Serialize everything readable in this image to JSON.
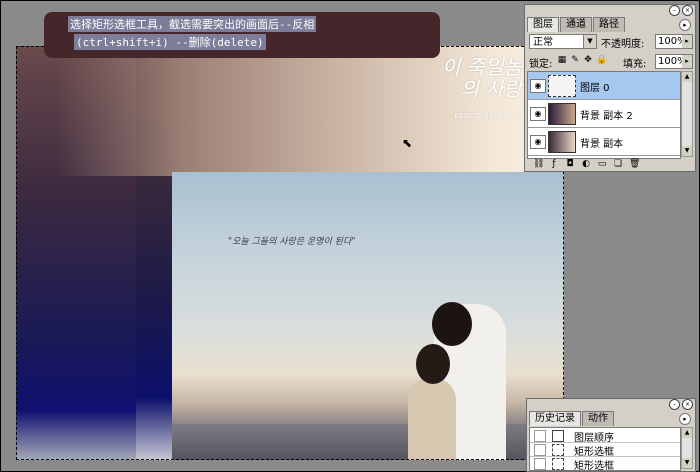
{
  "caption": {
    "line1": "选择矩形选框工具，截选需要突出的画面后--反相",
    "line2": "(ctrl+shift+i) --删除(delete)"
  },
  "image": {
    "quote": "\"오늘 그들의 사랑은 운명이 된다\"",
    "logo_text": "이 죽일놈의 사랑",
    "logo_sub": "KBS2 TV 월화미니시리즈"
  },
  "layers_panel": {
    "tabs": [
      "图层",
      "通道",
      "路径"
    ],
    "active_tab": 0,
    "blend_mode": "正常",
    "opacity_label": "不透明度:",
    "opacity_value": "100%",
    "lock_label": "锁定:",
    "fill_label": "填充:",
    "fill_value": "100%",
    "layers": [
      {
        "name": "图层 0",
        "selected": true
      },
      {
        "name": "背景 副本 2",
        "selected": false
      },
      {
        "name": "背景 副本",
        "selected": false
      }
    ],
    "icons": [
      "link-icon",
      "style-icon",
      "mask-icon",
      "adjustment-icon",
      "group-icon",
      "new-layer-icon",
      "trash-icon"
    ]
  },
  "history_panel": {
    "tabs": [
      "历史记录",
      "动作"
    ],
    "active_tab": 0,
    "items": [
      {
        "label": "图层顺序"
      },
      {
        "label": "矩形选框"
      },
      {
        "label": "矩形选框"
      }
    ]
  },
  "colors": {
    "caption_bg": "#45272b",
    "caption_highlight": "#7d7d9a",
    "panel_bg": "#d4d0c8",
    "selected_layer": "#a6c8ef",
    "workspace": "#8a8a8a"
  }
}
